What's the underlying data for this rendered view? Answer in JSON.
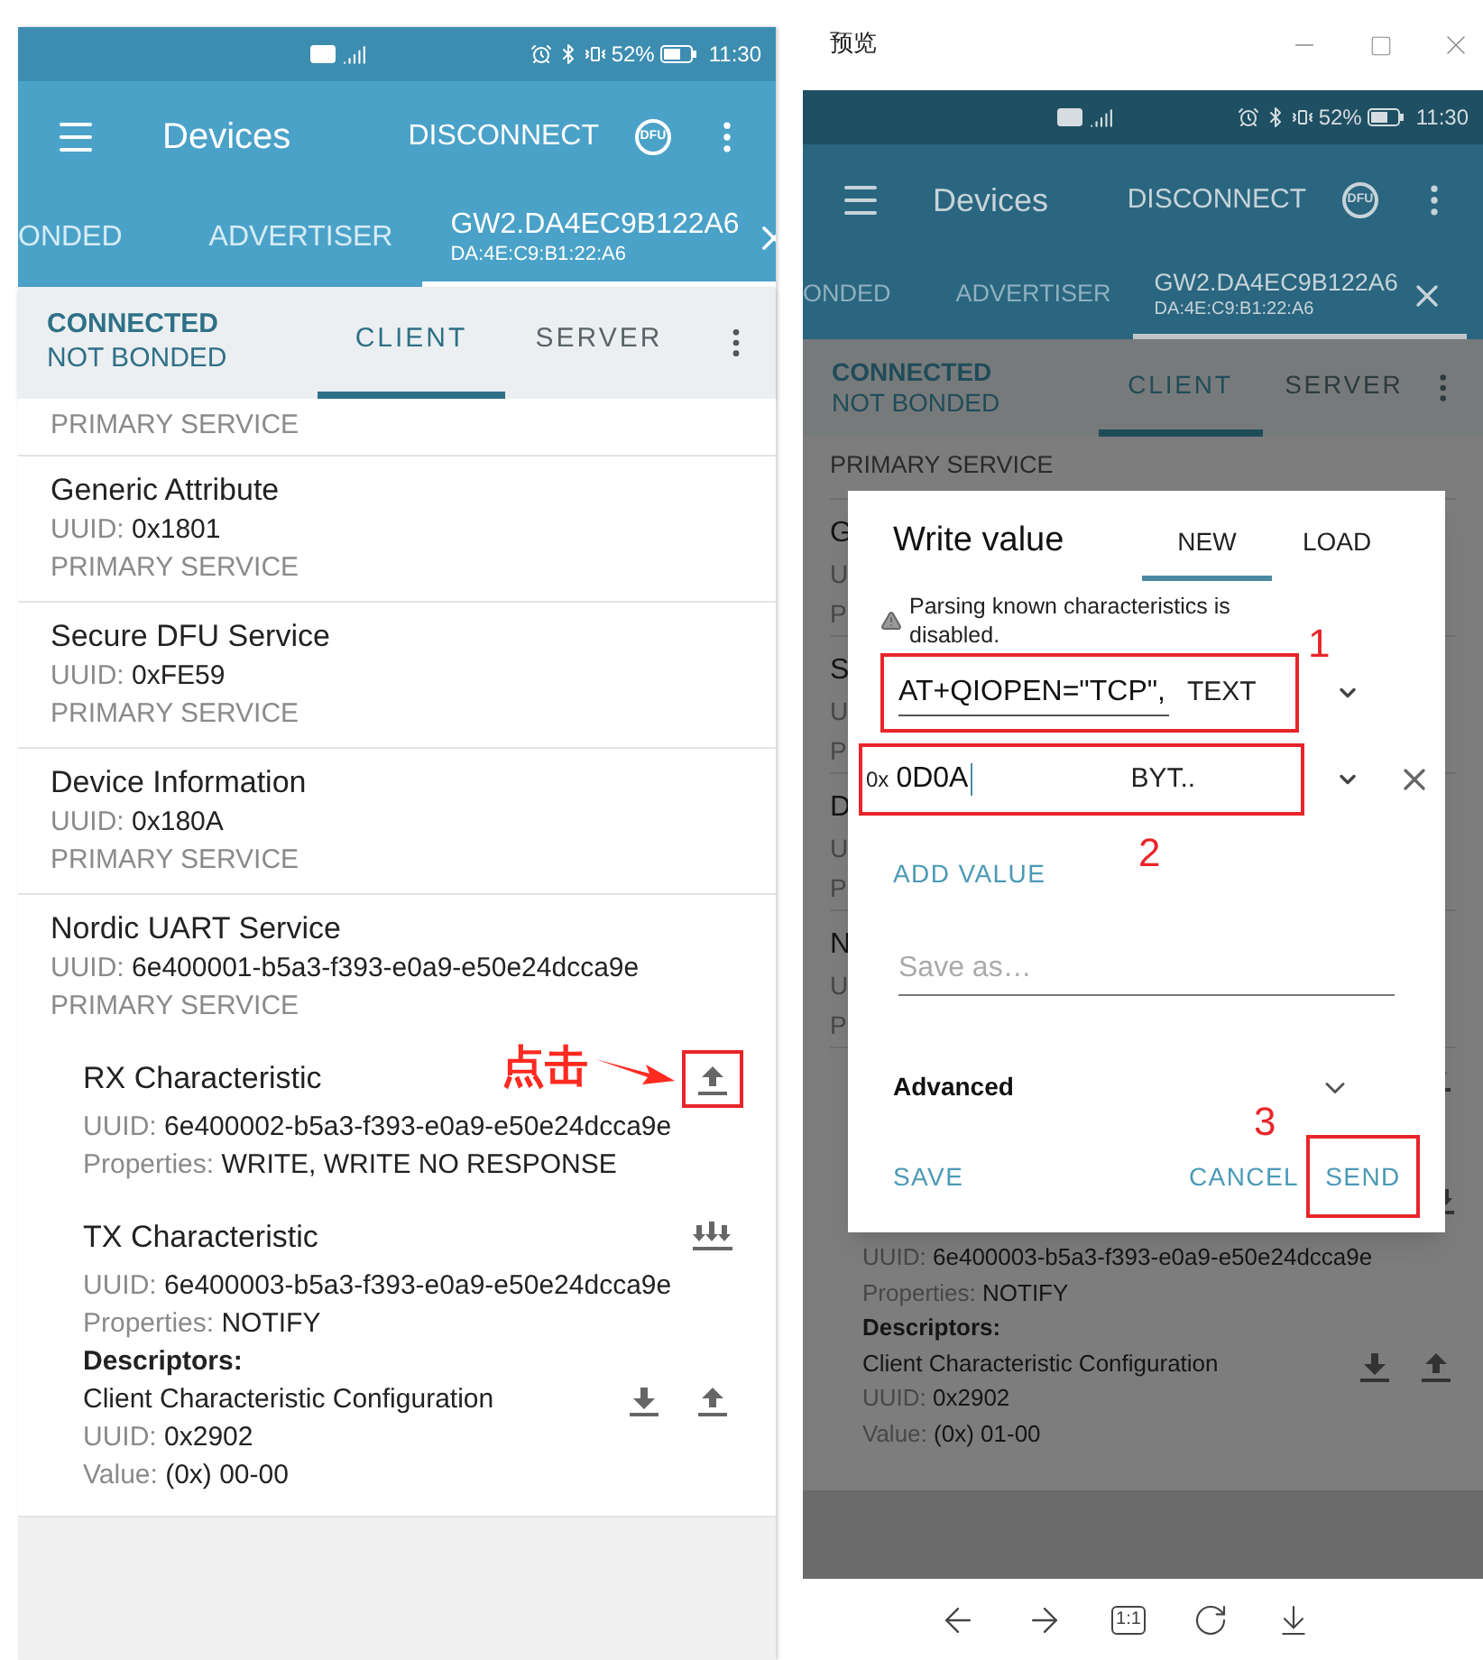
{
  "phone": {
    "status_bar": {
      "battery": "52%",
      "time": "11:30"
    },
    "app_bar": {
      "title": "Devices",
      "action": "DISCONNECT",
      "badge": "DFU"
    },
    "device_tabs": [
      {
        "label": "ONDED",
        "selected": false
      },
      {
        "label": "ADVERTISER",
        "selected": false
      },
      {
        "label": "GW2.DA4EC9B122A6",
        "address": "DA:4E:C9:B1:22:A6",
        "selected": true
      }
    ],
    "connection": {
      "state": "CONNECTED",
      "bond": "NOT BONDED"
    },
    "view_tabs": [
      {
        "label": "CLIENT",
        "selected": true
      },
      {
        "label": "SERVER",
        "selected": false
      }
    ],
    "services": [
      {
        "type": "PRIMARY SERVICE"
      },
      {
        "name": "Generic Attribute",
        "uuid_label": "UUID:",
        "uuid": "0x1801",
        "type": "PRIMARY SERVICE"
      },
      {
        "name": "Secure DFU Service",
        "uuid_label": "UUID:",
        "uuid": "0xFE59",
        "type": "PRIMARY SERVICE"
      },
      {
        "name": "Device Information",
        "uuid_label": "UUID:",
        "uuid": "0x180A",
        "type": "PRIMARY SERVICE"
      },
      {
        "name": "Nordic UART Service",
        "uuid_label": "UUID:",
        "uuid": "6e400001-b5a3-f393-e0a9-e50e24dcca9e",
        "type": "PRIMARY SERVICE",
        "characteristics": [
          {
            "name": "RX Characteristic",
            "uuid_label": "UUID:",
            "uuid": "6e400002-b5a3-f393-e0a9-e50e24dcca9e",
            "properties_label": "Properties:",
            "properties": "WRITE, WRITE NO RESPONSE",
            "kind": "write",
            "highlighted": true
          },
          {
            "name": "TX Characteristic",
            "uuid_label": "UUID:",
            "uuid": "6e400003-b5a3-f393-e0a9-e50e24dcca9e",
            "properties_label": "Properties:",
            "properties": "NOTIFY",
            "kind": "notify",
            "highlighted": false,
            "descriptors_heading": "Descriptors:",
            "descriptors": [
              {
                "name": "Client Characteristic Configuration",
                "uuid_label": "UUID:",
                "uuid": "0x2902",
                "value_label": "Value:",
                "value": "(0x) 00-00"
              }
            ]
          }
        ]
      }
    ],
    "annotation": {
      "label": "点击"
    }
  },
  "preview": {
    "title": "预览",
    "status_bar": {
      "battery": "52%",
      "time": "11:30"
    },
    "app_bar": {
      "title": "Devices",
      "action": "DISCONNECT",
      "badge": "DFU"
    },
    "device_tabs": [
      {
        "label": "ONDED",
        "selected": false
      },
      {
        "label": "ADVERTISER",
        "selected": false
      },
      {
        "label": "GW2.DA4EC9B122A6",
        "address": "DA:4E:C9:B1:22:A6",
        "selected": true
      }
    ],
    "connection": {
      "state": "CONNECTED",
      "bond": "NOT BONDED"
    },
    "view_tabs": [
      {
        "label": "CLIENT",
        "selected": true
      },
      {
        "label": "SERVER",
        "selected": false
      }
    ],
    "first_service_type": "PRIMARY SERVICE",
    "covered_rows": [
      [
        "G",
        "U",
        "P"
      ],
      [
        "S",
        "U",
        "P"
      ],
      [
        "D",
        "U",
        "P"
      ],
      [
        "N",
        "U",
        "P"
      ]
    ],
    "below_dialog": {
      "uuid_label": "UUID:",
      "uuid": "6e400003-b5a3-f393-e0a9-e50e24dcca9e",
      "properties_label": "Properties:",
      "properties": "NOTIFY",
      "descriptors_heading": "Descriptors:",
      "descriptor": {
        "name": "Client Characteristic Configuration",
        "uuid_label": "UUID:",
        "uuid": "0x2902",
        "value_label": "Value:",
        "value": "(0x) 01-00"
      }
    },
    "dialog": {
      "title": "Write value",
      "tabs": [
        {
          "label": "NEW",
          "selected": true
        },
        {
          "label": "LOAD",
          "selected": false
        }
      ],
      "warning": "Parsing known characteristics is disabled.",
      "values": [
        {
          "value": "AT+QIOPEN=\"TCP\",",
          "format": "TEXT",
          "step": "1",
          "removable": false
        },
        {
          "prefix": "0x",
          "value": "0D0A",
          "format": "BYT..",
          "step": "2",
          "removable": true
        }
      ],
      "add_value": "ADD VALUE",
      "save_as_placeholder": "Save as…",
      "advanced": "Advanced",
      "buttons": [
        {
          "label": "SAVE",
          "kind": "left"
        },
        {
          "label": "CANCEL",
          "kind": "plain"
        },
        {
          "label": "SEND",
          "kind": "highlighted",
          "step": "3"
        }
      ]
    },
    "toolbar": {
      "zoom_label": "1:1"
    }
  }
}
